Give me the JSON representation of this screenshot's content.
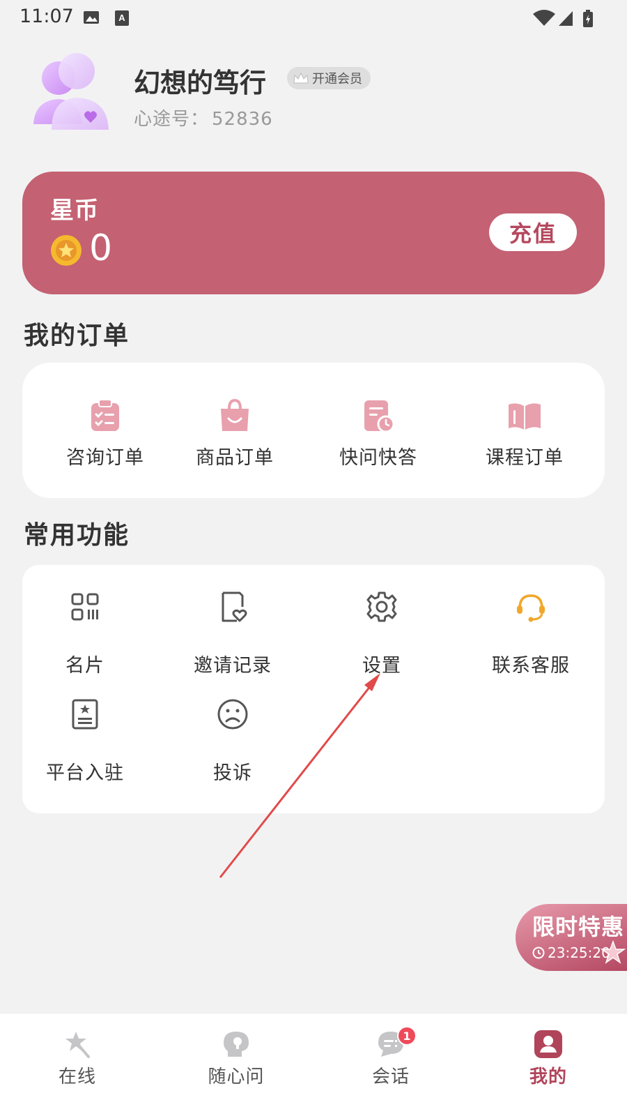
{
  "status_bar": {
    "time": "11:07"
  },
  "profile": {
    "nickname": "幻想的笃行",
    "vip_label": "开通会员",
    "id_label": "心途号：",
    "id_value": "52836"
  },
  "coin_card": {
    "title": "星币",
    "value": "0",
    "recharge_label": "充值",
    "color": "#c46172"
  },
  "orders": {
    "title": "我的订单",
    "items": [
      {
        "label": "咨询订单",
        "icon": "clipboard-check-icon"
      },
      {
        "label": "商品订单",
        "icon": "shopping-bag-icon"
      },
      {
        "label": "快问快答",
        "icon": "document-clock-icon"
      },
      {
        "label": "课程订单",
        "icon": "open-book-icon"
      }
    ]
  },
  "functions": {
    "title": "常用功能",
    "items": [
      {
        "label": "名片",
        "icon": "qr-code-icon"
      },
      {
        "label": "邀请记录",
        "icon": "document-heart-icon"
      },
      {
        "label": "设置",
        "icon": "gear-icon"
      },
      {
        "label": "联系客服",
        "icon": "headset-icon"
      },
      {
        "label": "平台入驻",
        "icon": "id-card-star-icon"
      },
      {
        "label": "投诉",
        "icon": "sad-face-icon"
      }
    ]
  },
  "promo": {
    "title": "限时特惠",
    "timer": "23:25:20"
  },
  "tab_bar": {
    "tabs": [
      {
        "label": "在线",
        "icon": "star-wand-icon"
      },
      {
        "label": "随心问",
        "icon": "lightbulb-head-icon"
      },
      {
        "label": "会话",
        "icon": "chat-bubble-icon",
        "badge": "1"
      },
      {
        "label": "我的",
        "icon": "user-profile-icon",
        "active": true
      }
    ],
    "active_color": "#b0445a"
  }
}
